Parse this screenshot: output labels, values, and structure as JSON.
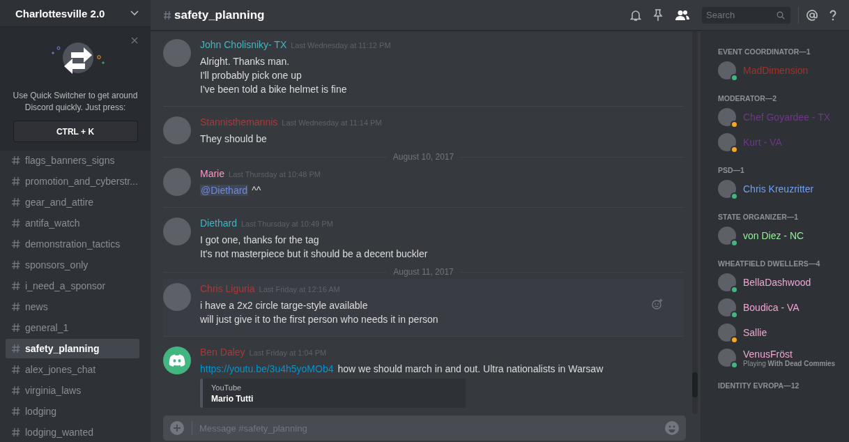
{
  "server": {
    "name": "Charlottesville 2.0"
  },
  "quick_switcher": {
    "text": "Use Quick Switcher to get around Discord quickly. Just press:",
    "shortcut": "CTRL + K"
  },
  "channels": [
    {
      "name": "flags_banners_signs",
      "selected": false
    },
    {
      "name": "promotion_and_cyberstr...",
      "selected": false
    },
    {
      "name": "gear_and_attire",
      "selected": false
    },
    {
      "name": "antifa_watch",
      "selected": false
    },
    {
      "name": "demonstration_tactics",
      "selected": false
    },
    {
      "name": "sponsors_only",
      "selected": false
    },
    {
      "name": "i_need_a_sponsor",
      "selected": false
    },
    {
      "name": "news",
      "selected": false
    },
    {
      "name": "general_1",
      "selected": false
    },
    {
      "name": "safety_planning",
      "selected": true
    },
    {
      "name": "alex_jones_chat",
      "selected": false
    },
    {
      "name": "virginia_laws",
      "selected": false
    },
    {
      "name": "lodging",
      "selected": false
    },
    {
      "name": "lodging_wanted",
      "selected": false
    }
  ],
  "header": {
    "channel": "safety_planning",
    "search": {
      "placeholder": "Search"
    }
  },
  "messages": [
    {
      "kind": "message",
      "author": "John Cholisniky- TX",
      "color": "#43b5c0",
      "time": "Last Wednesday at 11:12 PM",
      "hovered": false,
      "lines": [
        "Alright. Thanks man.",
        "I'll probably pick one up",
        "I've been told a bike helmet is fine"
      ]
    },
    {
      "kind": "message",
      "author": "Stannisthemannis",
      "color": "#a83a3a",
      "time": "Last Wednesday at 11:14 PM",
      "hovered": false,
      "lines": [
        "They should be"
      ]
    },
    {
      "kind": "divider",
      "date": "August 10, 2017"
    },
    {
      "kind": "message",
      "author": "Marie",
      "color": "#f49ac6",
      "time": "Last Thursday at 10:48 PM",
      "hovered": false,
      "lines": [
        [
          {
            "kind": "mention",
            "text": "@Diethard"
          },
          {
            "kind": "text",
            "text": "^^"
          }
        ]
      ]
    },
    {
      "kind": "message",
      "author": "Diethard",
      "color": "#43b5c0",
      "time": "Last Thursday at 10:49 PM",
      "hovered": false,
      "lines": [
        "I got one, thanks for the tag",
        "It's not masterpiece but it should be a decent buckler"
      ]
    },
    {
      "kind": "divider",
      "date": "August 11, 2017"
    },
    {
      "kind": "message",
      "author": "Chris Liguria",
      "color": "#a83a3a",
      "time": "Last Friday at 12:16 AM",
      "hovered": true,
      "lines": [
        "i have a 2x2 circle targe-style available",
        "will just give it to the first person who needs it in person"
      ]
    },
    {
      "kind": "message",
      "author": "Ben Daley",
      "color": "#a83a3a",
      "time": "Last Friday at 1:04 PM",
      "avatar": {
        "color": "#43b581"
      },
      "hovered": false,
      "lines": [
        [
          {
            "kind": "link",
            "text": "https://youtu.be/3u4h5yoMOb4"
          },
          {
            "kind": "text",
            "text": "how we should march in and out. Ultra nationalists in Warsaw"
          }
        ]
      ],
      "embed": {
        "provider": "YouTube",
        "title": "Mario Tutti"
      }
    }
  ],
  "composer": {
    "placeholder": "Message #safety_planning"
  },
  "member_groups": [
    {
      "title": "EVENT COORDINATOR—1",
      "members": [
        {
          "name": "MadDimension",
          "color": "#a3312c",
          "status_dot": {
            "color": "#43b581"
          }
        }
      ]
    },
    {
      "title": "MODERATOR—2",
      "members": [
        {
          "name": "Chef Goyardee - TX",
          "color": "#71368a",
          "status_dot": {
            "color": "#faa61a"
          }
        },
        {
          "name": "Kurt - VA",
          "color": "#71368a",
          "status_dot": {
            "color": "#faa61a"
          }
        }
      ]
    },
    {
      "title": "PSD—1",
      "members": [
        {
          "name": "Chris Kreuzritter",
          "color": "#6ea1f5",
          "status_dot": {
            "color": "#43b581"
          }
        }
      ]
    },
    {
      "title": "STATE ORGANIZER—1",
      "members": [
        {
          "name": "von Diez - NC",
          "color": "#95f09b",
          "status_dot": {
            "color": "#43b581"
          }
        }
      ]
    },
    {
      "title": "WHEATFIELD DWELLERS—4",
      "members": [
        {
          "name": "BellaDashwood",
          "color": "#f0a6d2",
          "status_dot": {
            "color": "#43b581"
          }
        },
        {
          "name": "Boudica - VA",
          "color": "#f0a6d2",
          "status_dot": {
            "color": "#43b581"
          }
        },
        {
          "name": "Sallie",
          "color": "#f0a6d2",
          "status_dot": {
            "color": "#faa61a"
          }
        },
        {
          "name": "VenusFröst",
          "color": "#f0a6d2",
          "status_dot": {
            "color": "#43b581"
          },
          "activity": "Playing **With Dead Commies**"
        }
      ]
    },
    {
      "title": "IDENTITY EVROPA—12"
    }
  ]
}
